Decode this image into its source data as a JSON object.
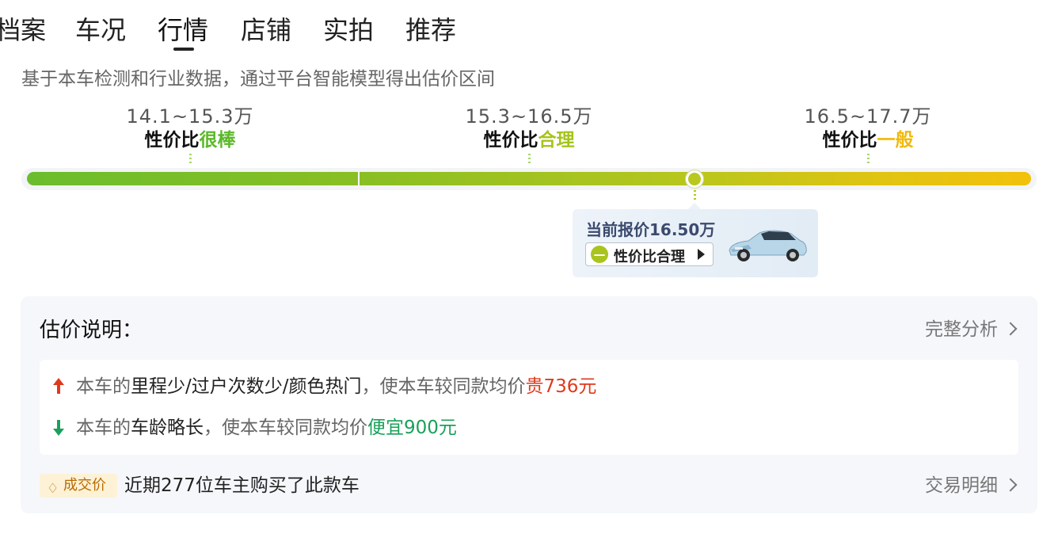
{
  "tabs": [
    "档案",
    "车况",
    "行情",
    "店铺",
    "实拍",
    "推荐"
  ],
  "active_tab": "行情",
  "subtitle": "基于本车检测和行业数据，通过平台智能模型得出估价区间",
  "ranges": [
    {
      "price": "14.1~15.3万",
      "prefix": "性价比",
      "level": "很棒",
      "color": "#5cb82a"
    },
    {
      "price": "15.3~16.5万",
      "prefix": "性价比",
      "level": "合理",
      "color": "#a5c41a"
    },
    {
      "price": "16.5~17.7万",
      "prefix": "性价比",
      "level": "一般",
      "color": "#f0b90b"
    }
  ],
  "current": {
    "price_label": "当前报价16.50万",
    "rating": "性价比合理",
    "icon_glyph": "—"
  },
  "explanation": {
    "title": "估价说明：",
    "full_link": "完整分析",
    "item1": {
      "pre": "本车的",
      "hl": "里程少/过户次数少/颜色热门",
      "mid": "，使本车较同款均价",
      "val": "贵736元"
    },
    "item2": {
      "pre": "本车的",
      "hl": "车龄略长",
      "mid": "，使本车较同款均价",
      "val": "便宜900元"
    },
    "deal_badge": "成交价",
    "deal_badge_icon": "♢",
    "deal_text": "近期277位车主购买了此款车",
    "deal_link": "交易明细"
  },
  "colors": {
    "up": "#e0391a",
    "down": "#1aa05a",
    "marker": "#b8c81e"
  }
}
